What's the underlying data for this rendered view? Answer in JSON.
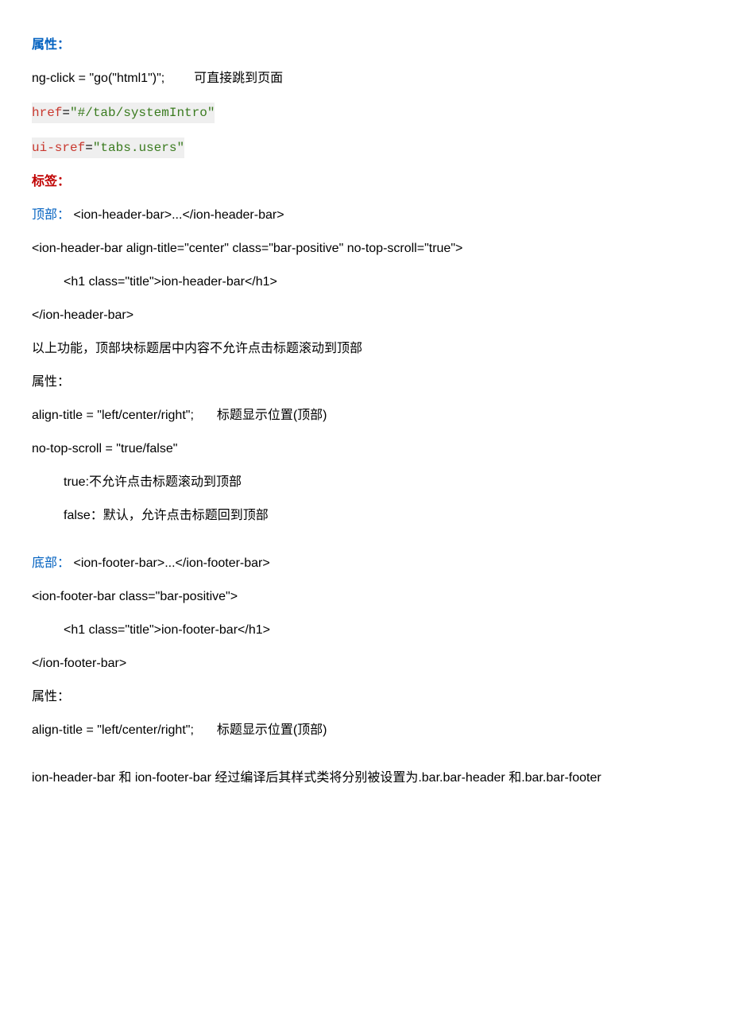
{
  "section1_title": "属性：",
  "line1a": "ng-click = \"go(\"html1\")\";",
  "line1b": "可直接跳到页面",
  "code1_attr": "href",
  "code1_eq": "=",
  "code1_val": "\"#/tab/systemIntro\"",
  "code2_attr": "ui-sref",
  "code2_eq": "=",
  "code2_val": "\"tabs.users\"",
  "section2_title": "标签：",
  "top_label": "顶部：",
  "top_tag": "<ion-header-bar>...</ion-header-bar>",
  "header_open": "<ion-header-bar align-title=\"center\" class=\"bar-positive\" no-top-scroll=\"true\">",
  "header_h1": "<h1 class=\"title\">ion-header-bar</h1>",
  "header_close": "</ion-header-bar>",
  "header_desc": "以上功能，顶部块标题居中内容不允许点击标题滚动到顶部",
  "attr_label2": "属性：",
  "align_title_line_a": "align-title = \"left/center/right\";",
  "align_title_line_b": "标题显示位置(顶部)",
  "no_top_scroll": "no-top-scroll = \"true/false\"",
  "no_top_true": "true:不允许点击标题滚动到顶部",
  "no_top_false": "false：默认，允许点击标题回到顶部",
  "bottom_label": "底部：",
  "bottom_tag": "<ion-footer-bar>...</ion-footer-bar>",
  "footer_open": "<ion-footer-bar class=\"bar-positive\">",
  "footer_h1": "<h1 class=\"title\">ion-footer-bar</h1>",
  "footer_close": "</ion-footer-bar>",
  "attr_label3": "属性：",
  "align_title2_a": "align-title = \"left/center/right\";",
  "align_title2_b": "标题显示位置(顶部)",
  "final_note": "ion-header-bar 和 ion-footer-bar 经过编译后其样式类将分别被设置为.bar.bar-header  和.bar.bar-footer"
}
